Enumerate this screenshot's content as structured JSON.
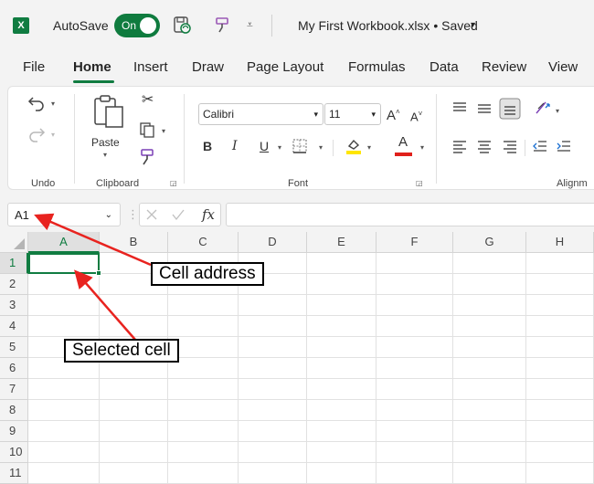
{
  "titlebar": {
    "app_icon_letter": "X",
    "autosave_label": "AutoSave",
    "autosave_state": "On",
    "document_title": "My First Workbook.xlsx • Saved",
    "title_caret": "▾"
  },
  "menu": {
    "tabs": [
      "File",
      "Home",
      "Insert",
      "Draw",
      "Page Layout",
      "Formulas",
      "Data",
      "Review",
      "View"
    ],
    "active_tab": "Home"
  },
  "ribbon": {
    "groups": {
      "undo": "Undo",
      "clipboard": "Clipboard",
      "font": "Font",
      "alignment": "Alignm"
    },
    "paste_label": "Paste",
    "font_name": "Calibri",
    "font_size": "11",
    "bold": "B",
    "italic": "I",
    "underline": "U"
  },
  "formula_bar": {
    "name_box_value": "A1",
    "fx_label": "fx",
    "formula_value": ""
  },
  "grid": {
    "columns": [
      "A",
      "B",
      "C",
      "D",
      "E",
      "F",
      "G",
      "H"
    ],
    "rows": [
      "1",
      "2",
      "3",
      "4",
      "5",
      "6",
      "7",
      "8",
      "9",
      "10",
      "11"
    ],
    "selected_cell": "A1"
  },
  "annotations": {
    "cell_address": "Cell address",
    "selected_cell": "Selected cell",
    "arrow_color": "#e8231f"
  },
  "colors": {
    "accent": "#107c41",
    "chrome": "#f3f3f3"
  }
}
